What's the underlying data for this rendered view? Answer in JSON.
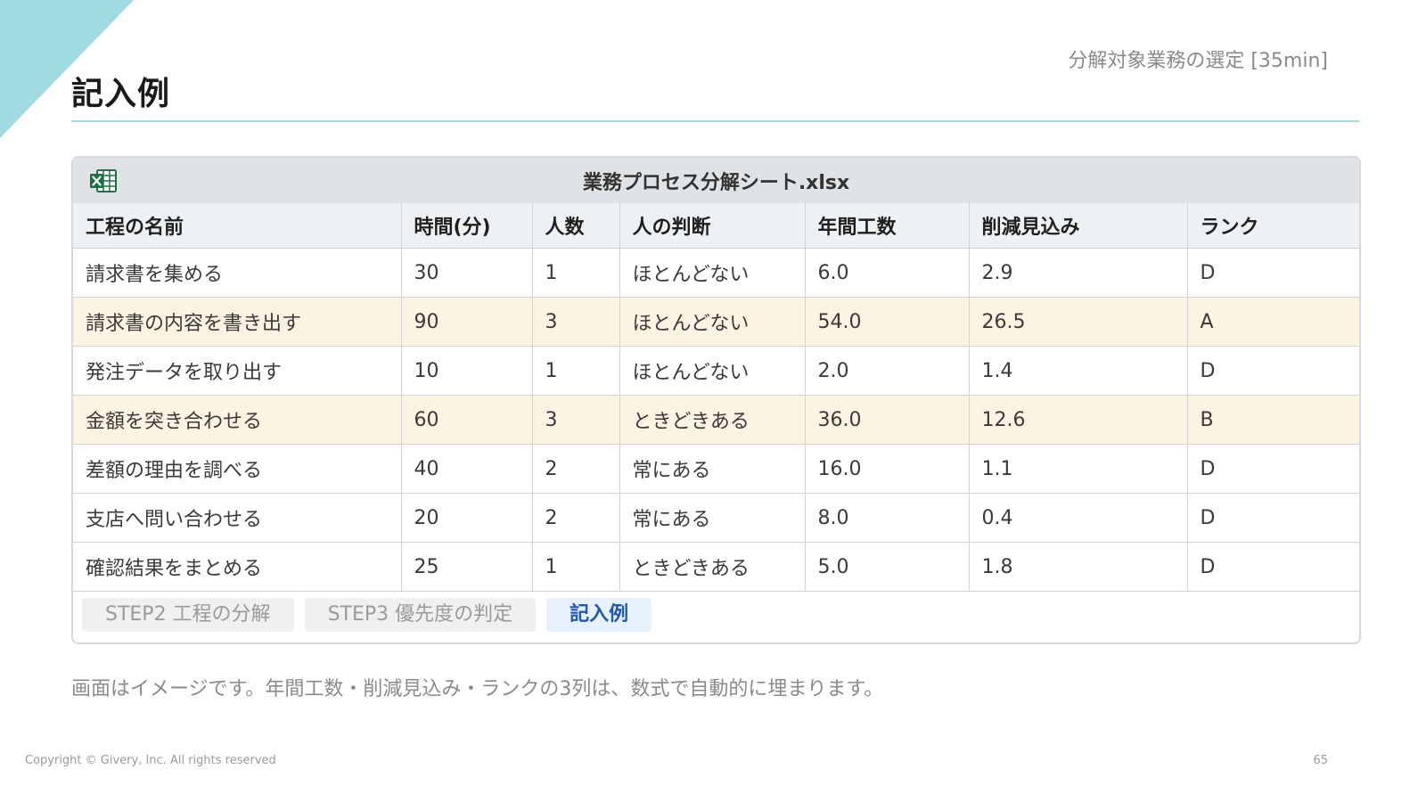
{
  "page": {
    "title": "記入例",
    "section_label": "分解対象業務の選定 [35min]",
    "note": "画面はイメージです。年間工数・削減見込み・ランクの3列は、数式で自動的に埋まります。",
    "copyright": "Copyright © Givery, Inc. All rights reserved",
    "page_number": "65"
  },
  "sheet": {
    "filename": "業務プロセス分解シート.xlsx",
    "icon": "excel-icon",
    "columns": [
      "工程の名前",
      "時間(分)",
      "人数",
      "人の判断",
      "年間工数",
      "削減見込み",
      "ランク"
    ],
    "rows": [
      [
        "請求書を集める",
        "30",
        "1",
        "ほとんどない",
        "6.0",
        "2.9",
        "D"
      ],
      [
        "請求書の内容を書き出す",
        "90",
        "3",
        "ほとんどない",
        "54.0",
        "26.5",
        "A"
      ],
      [
        "発注データを取り出す",
        "10",
        "1",
        "ほとんどない",
        "2.0",
        "1.4",
        "D"
      ],
      [
        "金額を突き合わせる",
        "60",
        "3",
        "ときどきある",
        "36.0",
        "12.6",
        "B"
      ],
      [
        "差額の理由を調べる",
        "40",
        "2",
        "常にある",
        "16.0",
        "1.1",
        "D"
      ],
      [
        "支店へ問い合わせる",
        "20",
        "2",
        "常にある",
        "8.0",
        "0.4",
        "D"
      ],
      [
        "確認結果をまとめる",
        "25",
        "1",
        "ときどきある",
        "5.0",
        "1.8",
        "D"
      ]
    ],
    "tabs": [
      {
        "label": "STEP2 工程の分解",
        "active": false
      },
      {
        "label": "STEP3 優先度の判定",
        "active": false
      },
      {
        "label": "記入例",
        "active": true
      }
    ]
  },
  "colors": {
    "accent_corner": "#9fdbe1",
    "highlight_row": "#fdf3e2",
    "active_tab_text": "#2457b0",
    "excel_green": "#1e7145"
  }
}
